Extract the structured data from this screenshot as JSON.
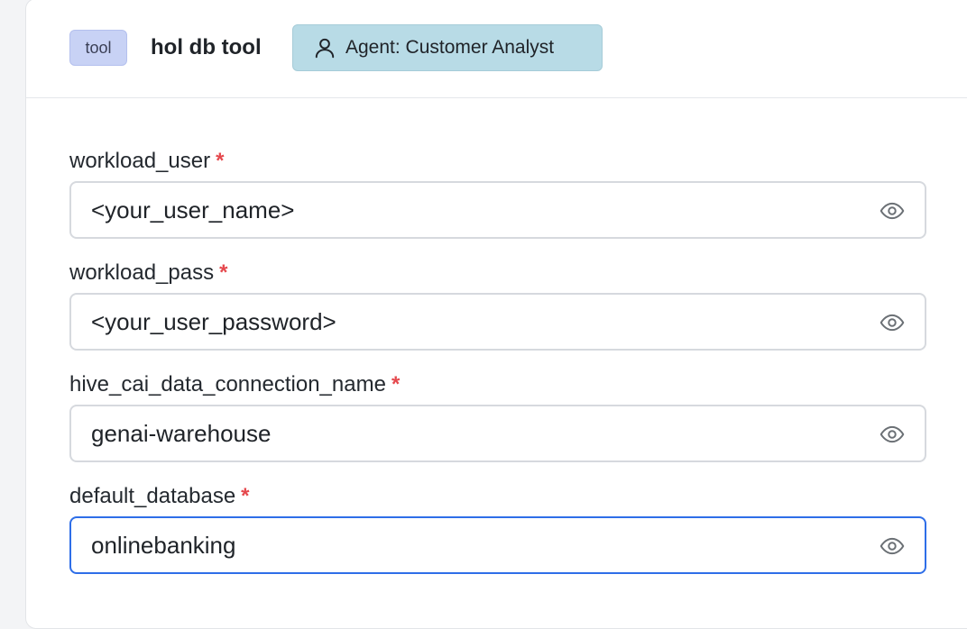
{
  "header": {
    "tag_label": "tool",
    "title": "hol db tool",
    "agent_badge": "Agent: Customer Analyst"
  },
  "fields": [
    {
      "label": "workload_user",
      "required_mark": "*",
      "value": "<your_user_name>",
      "icon": "eye-icon"
    },
    {
      "label": "workload_pass",
      "required_mark": "*",
      "value": "<your_user_password>",
      "icon": "eye-icon"
    },
    {
      "label": "hive_cai_data_connection_name",
      "required_mark": "*",
      "value": "genai-warehouse",
      "icon": "eye-icon"
    },
    {
      "label": "default_database",
      "required_mark": "*",
      "value": "onlinebanking",
      "icon": "eye-icon",
      "focused": true
    }
  ],
  "colors": {
    "tag_bg": "#c8d2f5",
    "agent_bg": "#b8dbe6",
    "required": "#e5484d",
    "focus_border": "#2e6ee8"
  }
}
